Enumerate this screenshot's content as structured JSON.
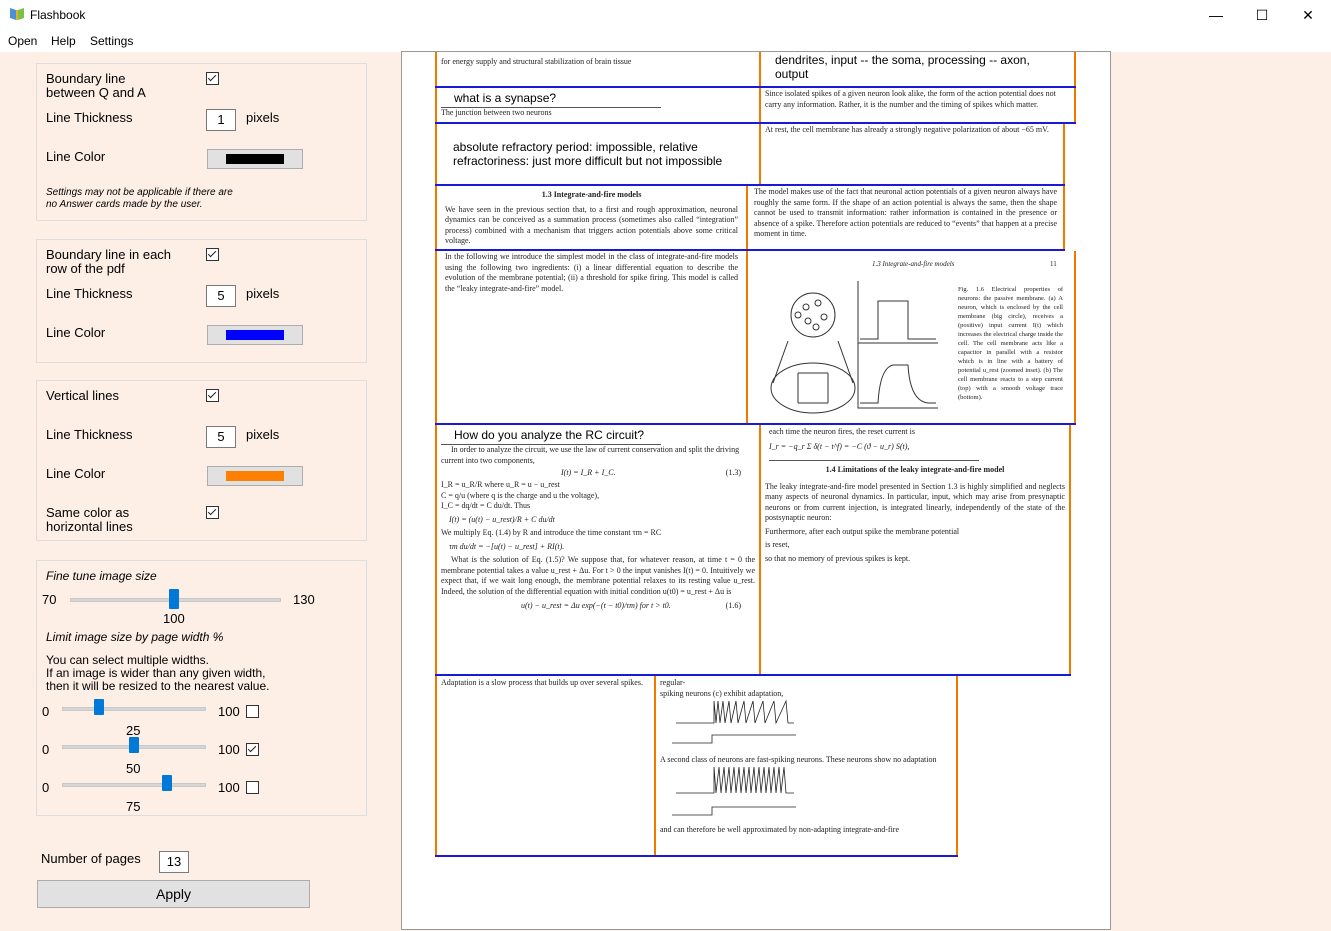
{
  "window": {
    "title": "Flashbook",
    "minimize": "—",
    "maximize": "☐",
    "close": "✕"
  },
  "menu": [
    "Open",
    "Help",
    "Settings"
  ],
  "qa_group": {
    "boundary_label": "Boundary line\nbetween Q and A",
    "boundary_checked": true,
    "thickness_label": "Line Thickness",
    "thickness_value": "1",
    "pixels": "pixels",
    "color_label": "Line Color",
    "color": "#000000",
    "note": "Settings may not be applicable if there are\nno Answer cards made by the user."
  },
  "row_group": {
    "boundary_label": "Boundary line in each\nrow of the pdf",
    "boundary_checked": true,
    "thickness_label": "Line Thickness",
    "thickness_value": "5",
    "pixels": "pixels",
    "color_label": "Line Color",
    "color": "#0000ff"
  },
  "vertical_group": {
    "label": "Vertical lines",
    "checked": true,
    "thickness_label": "Line Thickness",
    "thickness_value": "5",
    "pixels": "pixels",
    "color_label": "Line Color",
    "color": "#ff7f00",
    "same_color_label": "Same color as\nhorizontal lines",
    "same_color_checked": true
  },
  "size_group": {
    "fine_tune_label": "Fine tune image size",
    "fine_min": "70",
    "fine_max": "130",
    "fine_value": "100",
    "limit_label": "Limit image size by page width %",
    "help": "You can select multiple widths.\nIf an image is wider than any given width,\nthen it will be resized to the nearest value.",
    "sliders": [
      {
        "min": "0",
        "max": "100",
        "value": "25",
        "checked": false
      },
      {
        "min": "0",
        "max": "100",
        "value": "50",
        "checked": true
      },
      {
        "min": "0",
        "max": "100",
        "value": "75",
        "checked": false
      }
    ]
  },
  "pages": {
    "label": "Number of pages",
    "value": "13"
  },
  "apply_label": "Apply",
  "pdf": {
    "c1": "for energy supply and structural stabilization of brain tissue",
    "c2": "dendrites, input -- the soma, processing -- axon, output",
    "q1": "what is a synapse?",
    "q1_answer": "The junction between two neurons",
    "c3": "Since isolated spikes of a given neuron look alike, the form of the action potential does not carry any information. Rather, it is the number and the timing of spikes which matter.",
    "q2": "absolute refractory period: impossible, relative refractoriness: just more difficult but not impossible",
    "c4": "At rest, the cell membrane has already a strongly negative polarization of about −65 mV.",
    "sec13": "1.3  Integrate-and-fire models",
    "p13": "We have seen in the previous section that, to a first and rough approximation, neuronal dynamics can be conceived as a summation process (sometimes also called “integration” process) combined with a mechanism that triggers action potentials above some critical voltage.",
    "c5": "The model makes use of the fact that neuronal action potentials of a given neuron always have roughly the same form. If the shape of an action potential is always the same, then the shape cannot be used to transmit information: rather information is contained in the presence or absence of a spike. Therefore action potentials are reduced to “events” that happen at a precise moment in time.",
    "p14": "In the following we introduce the simplest model in the class of integrate-and-fire models using the following two ingredients: (i) a linear differential equation to describe the evolution of the membrane potential; (ii) a threshold for spike firing. This model is called the “leaky integrate-and-fire” model.",
    "fig_header": "1.3  Integrate-and-fire models",
    "fig_page": "11",
    "fig_caption": "Fig. 1.6 Electrical properties of neurons: the passive membrane. (a) A neuron, which is enclosed by the cell membrane (big circle), receives a (positive) input current I(t) which increases the electrical charge inside the cell. The cell membrane acts like a capacitor in parallel with a resistor which is in line with a battery of potential u_rest (zoomed inset). (b) The cell membrane reacts to a step current (top) with a smooth voltage trace (bottom).",
    "q3": "How do you analyze the RC circuit?",
    "rc1": "In order to analyze the circuit, we use the law of current conservation and split the driving current into two components,",
    "rc_eq1": "I(t) = I_R + I_C.",
    "rc_eq1n": "(1.3)",
    "rc2": "I_R = u_R/R where u_R = u − u_rest",
    "rc3": "C = q/u (where q is the charge and u the voltage),",
    "rc4": "I_C = dq/dt = C du/dt. Thus",
    "rc_eq2": "I(t) = (u(t) − u_rest)/R + C du/dt",
    "rc5": "We multiply Eq. (1.4) by R and introduce the time constant τm = RC",
    "rc_eq3": "τm du/dt = −[u(t) − u_rest] + RI(t).",
    "rc6": "What is the solution of Eq. (1.5)? We suppose that, for whatever reason, at time t = 0 the membrane potential takes a value u_rest + Δu. For t > 0 the input vanishes I(t) = 0. Intuitively we expect that, if we wait long enough, the membrane potential relaxes to its resting value u_rest. Indeed, the solution of the differential equation with initial condition u(t0) = u_rest + Δu is",
    "rc_eq4": "u(t) − u_rest = Δu exp(−(t − t0)/τm)   for t > t0.",
    "rc_eq4n": "(1.6)",
    "reset1": "each time the neuron fires, the reset current is",
    "reset_eq": "I_r = −q_r Σ δ(t − t^f) = −C (ϑ − u_r) S(t),",
    "sec14": "1.4  Limitations of the leaky integrate-and-fire model",
    "p15": "The leaky integrate-and-fire model presented in Section 1.3 is highly simplified and neglects many aspects of neuronal dynamics. In particular, input, which may arise from presynaptic neurons or from current injection, is integrated linearly, independently of the state of the postsynaptic neuron:",
    "p16": "Furthermore, after each output spike the membrane potential",
    "p17": "is reset,",
    "p18": "so that no memory of previous spikes is kept.",
    "adapt": "Adaptation is a slow process that builds up over several spikes.",
    "regular": "regular-\nspiking neurons (c) exhibit adaptation,",
    "fast": "A second class of neurons are fast-spiking neurons. These neurons show no adaptation",
    "nonadapt": "and can therefore be well approximated by non-adapting integrate-and-fire"
  }
}
